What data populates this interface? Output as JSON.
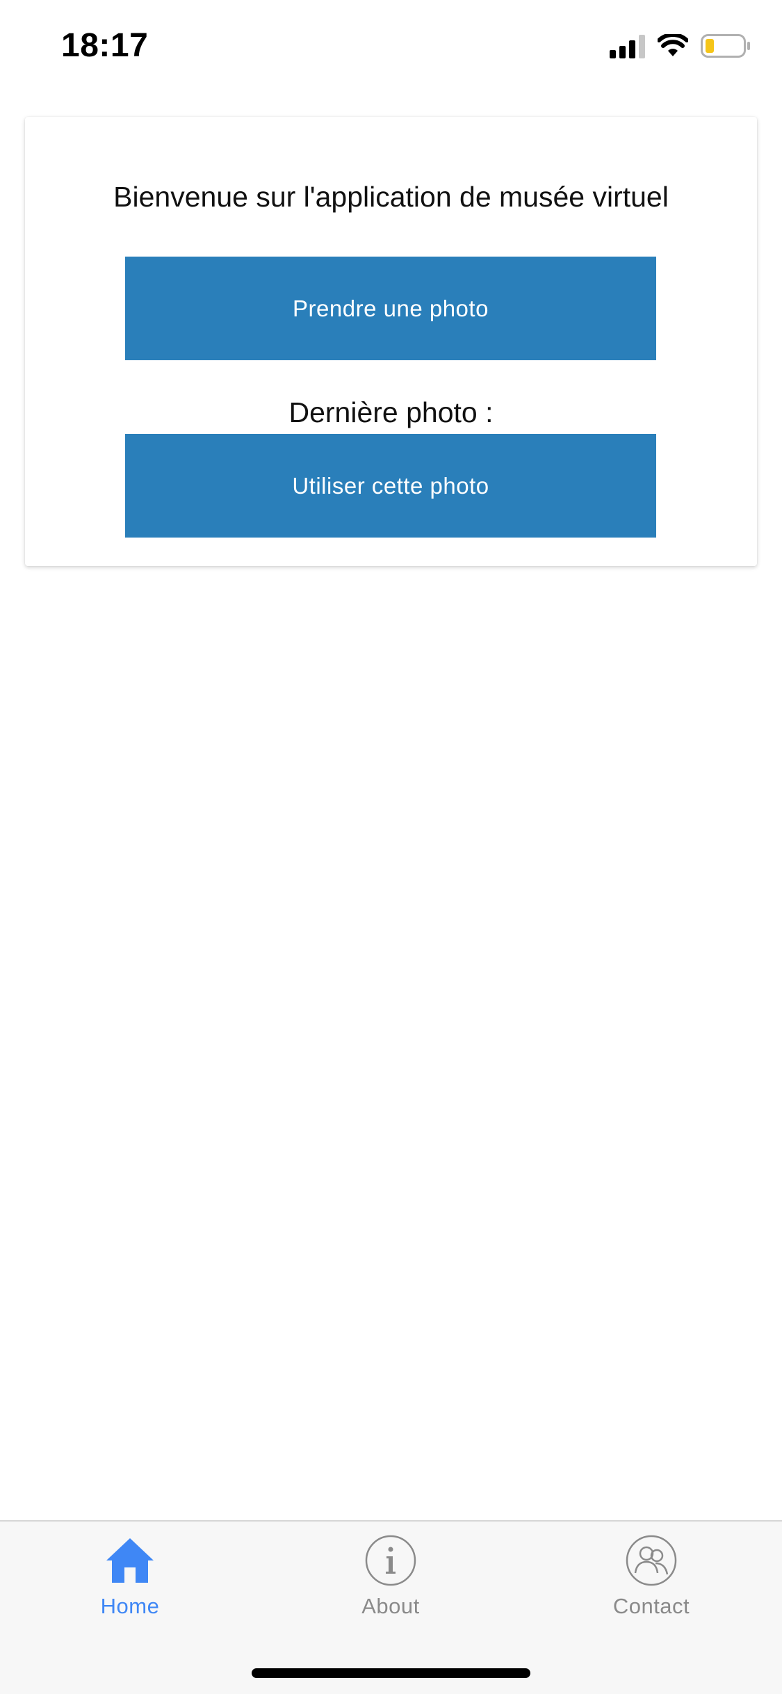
{
  "status_bar": {
    "time": "18:17",
    "icons": [
      "cellular-signal-icon",
      "wifi-icon",
      "battery-icon"
    ],
    "battery_color": "#f5c518"
  },
  "card": {
    "title": "Bienvenue sur l'application de musée virtuel",
    "take_photo_label": "Prendre une photo",
    "last_photo_label": "Dernière photo :",
    "use_photo_label": "Utiliser cette photo",
    "button_color": "#2a7fba"
  },
  "tabs": [
    {
      "label": "Home",
      "icon": "home-icon",
      "active": true,
      "color": "#3f87f5"
    },
    {
      "label": "About",
      "icon": "info-icon",
      "active": false,
      "color": "#8a8a8a"
    },
    {
      "label": "Contact",
      "icon": "contacts-icon",
      "active": false,
      "color": "#8a8a8a"
    }
  ]
}
